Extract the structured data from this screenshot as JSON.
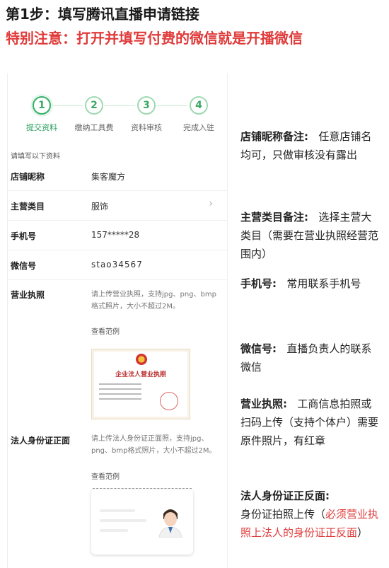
{
  "heading": {
    "line1": "第1步：填写腾讯直播申请链接",
    "line2": "特别注意：打开并填写付费的微信就是开播微信"
  },
  "steps": [
    {
      "num": "1",
      "label": "提交资料"
    },
    {
      "num": "2",
      "label": "缴纳工具费"
    },
    {
      "num": "3",
      "label": "资料审核"
    },
    {
      "num": "4",
      "label": "完成入驻"
    }
  ],
  "form": {
    "caption": "请填写以下资料",
    "shop_name": {
      "label": "店铺昵称",
      "value": "集客魔方"
    },
    "category": {
      "label": "主营类目",
      "value": "服饰"
    },
    "phone": {
      "label": "手机号",
      "value": "157*****28"
    },
    "wechat": {
      "label": "微信号",
      "value": "stao34567"
    },
    "license": {
      "label": "营业执照",
      "hint": "请上传营业执照，支持jpg、png、bmp格式照片，大小不超过2M。",
      "link": "查看范例",
      "image_title": "企业法人营业执照"
    },
    "id_card": {
      "label": "法人身份证正面",
      "hint": "请上传法人身份证正面照，支持jpg、png、bmp格式照片，大小不超过2M。",
      "link": "查看范例"
    }
  },
  "notes": [
    {
      "title": "店铺昵称备注:",
      "body": "任意店铺名均可，只做审核没有露出",
      "red": ""
    },
    {
      "title": "主营类目备注:",
      "body": "选择主营大类目（需要在营业执照经营范围内）",
      "red": ""
    },
    {
      "title": "手机号:",
      "body": "常用联系手机号",
      "red": ""
    },
    {
      "title": "微信号:",
      "body": "直播负责人的联系微信",
      "red": ""
    },
    {
      "title": "营业执照:",
      "body": "工商信息拍照或扫码上传（支持个体户）需要原件照片，有红章",
      "red": ""
    },
    {
      "title": "法人身份证正反面:",
      "body": "身份证拍照上传（",
      "red": "必须营业执照上法人的身份证正反面",
      "tail": "）"
    }
  ],
  "colors": {
    "accent_green": "#35b06a",
    "warning_red": "#e03b3b"
  }
}
